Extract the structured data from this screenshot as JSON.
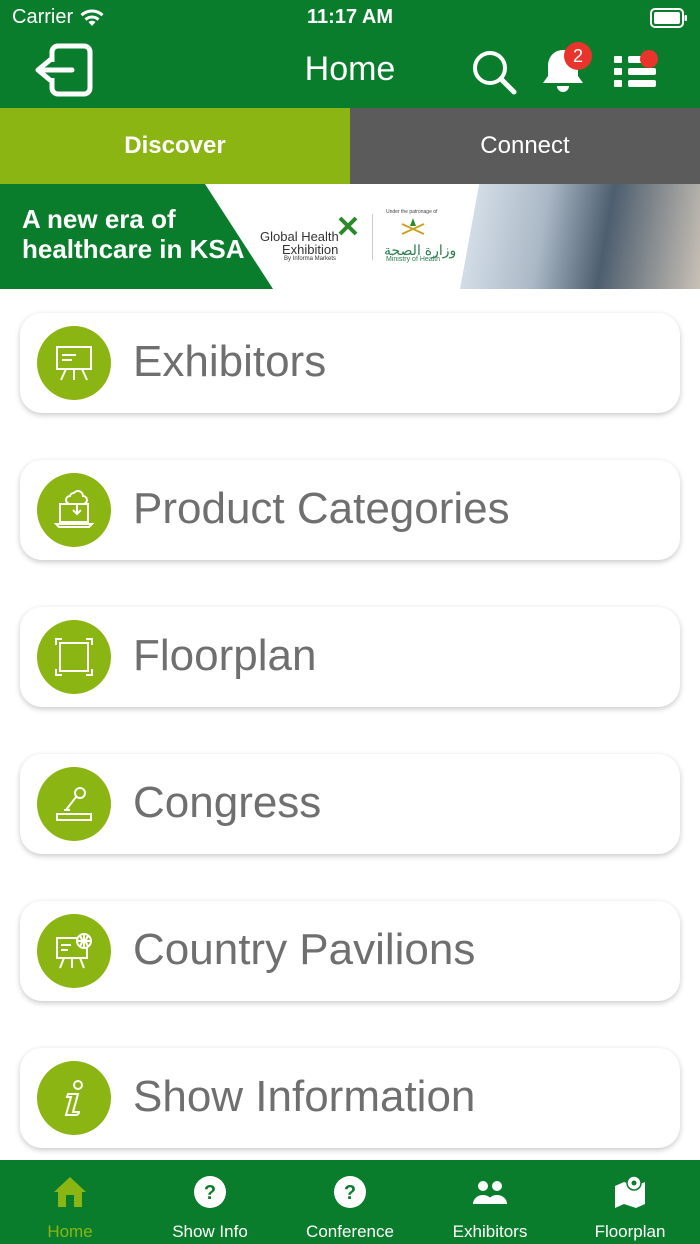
{
  "status_bar": {
    "carrier": "Carrier",
    "time": "11:17 AM"
  },
  "header": {
    "title": "Home",
    "notification_count": "2"
  },
  "tabs": [
    {
      "label": "Discover",
      "active": true
    },
    {
      "label": "Connect",
      "active": false
    }
  ],
  "banner": {
    "headline_line1": "A new era of",
    "headline_line2": "healthcare in KSA",
    "ghe_line1": "Global Health",
    "ghe_line2": "Exhibition",
    "ghe_sub": "By Informa Markets",
    "moh_top": "Under the patronage of",
    "moh_ar": "وزارة الصحة",
    "moh_en": "Ministry of Health"
  },
  "menu": [
    {
      "label": "Exhibitors",
      "icon": "presentation-board-icon"
    },
    {
      "label": "Product Categories",
      "icon": "laptop-cloud-icon"
    },
    {
      "label": "Floorplan",
      "icon": "frame-icon"
    },
    {
      "label": "Congress",
      "icon": "microphone-stand-icon"
    },
    {
      "label": "Country Pavilions",
      "icon": "globe-board-icon"
    },
    {
      "label": "Show Information",
      "icon": "info-icon"
    }
  ],
  "bottom_nav": [
    {
      "label": "Home",
      "icon": "home-icon",
      "active": true
    },
    {
      "label": "Show Info",
      "icon": "question-icon",
      "active": false
    },
    {
      "label": "Conference",
      "icon": "question-icon",
      "active": false
    },
    {
      "label": "Exhibitors",
      "icon": "people-icon",
      "active": false
    },
    {
      "label": "Floorplan",
      "icon": "map-pin-icon",
      "active": false
    }
  ],
  "colors": {
    "primary_green": "#0a7d2c",
    "accent_lime": "#8ab512",
    "tab_gray": "#5b5b5b",
    "badge_red": "#e8342b",
    "label_gray": "#6f6f6f"
  }
}
